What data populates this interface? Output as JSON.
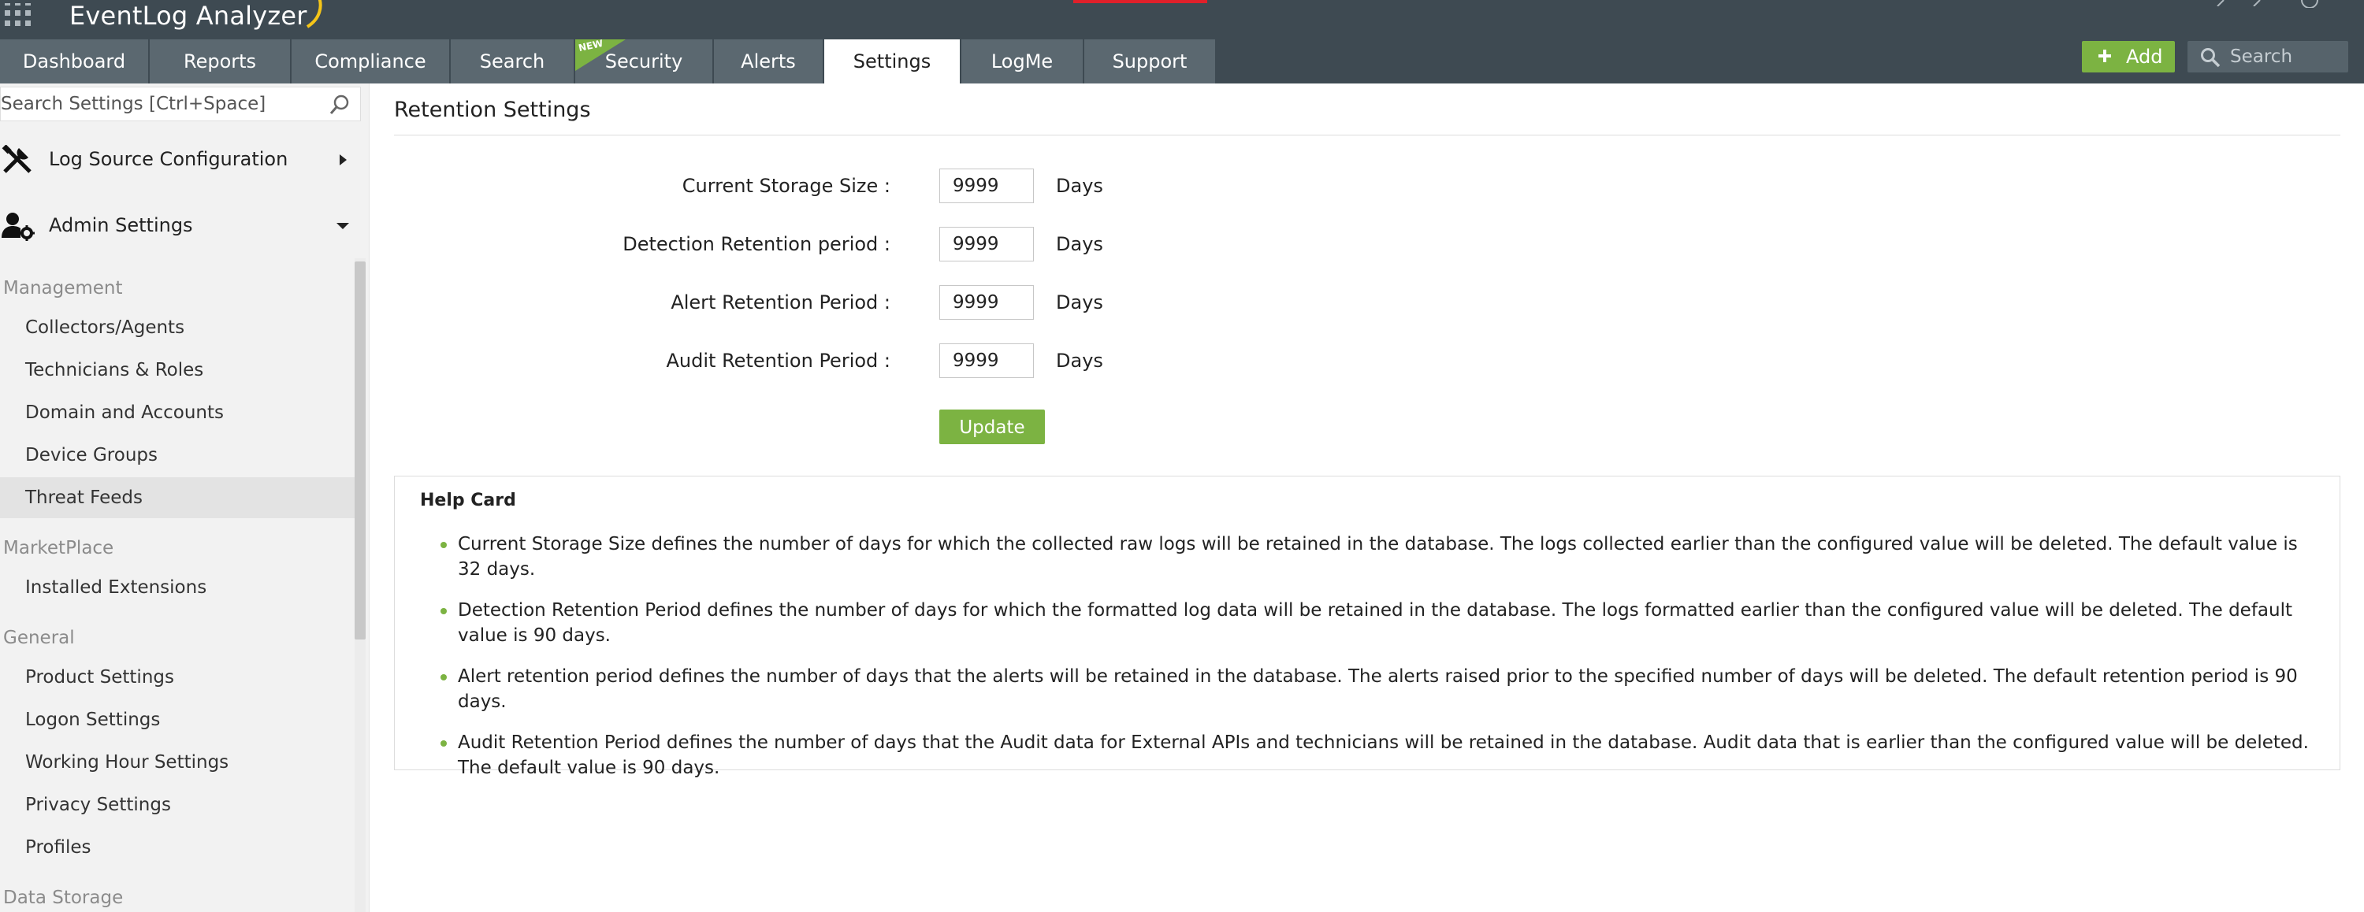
{
  "app": {
    "title": "EventLog Analyzer"
  },
  "nav": {
    "tabs": [
      {
        "label": "Dashboard"
      },
      {
        "label": "Reports"
      },
      {
        "label": "Compliance"
      },
      {
        "label": "Search"
      },
      {
        "label": "Security",
        "badge": "NEW"
      },
      {
        "label": "Alerts"
      },
      {
        "label": "Settings",
        "active": true
      },
      {
        "label": "LogMe"
      },
      {
        "label": "Support"
      }
    ],
    "add_label": "Add",
    "search_placeholder": "Search"
  },
  "sidebar": {
    "search_placeholder": "Search Settings [Ctrl+Space]",
    "sections": [
      {
        "label": "Log Source Configuration",
        "expanded": false
      },
      {
        "label": "Admin Settings",
        "expanded": true
      }
    ],
    "groups": [
      {
        "title": "Management",
        "items": [
          "Collectors/Agents",
          "Technicians & Roles",
          "Domain and Accounts",
          "Device Groups",
          "Threat Feeds"
        ]
      },
      {
        "title": "MarketPlace",
        "items": [
          "Installed Extensions"
        ]
      },
      {
        "title": "General",
        "items": [
          "Product Settings",
          "Logon Settings",
          "Working Hour Settings",
          "Privacy Settings",
          "Profiles"
        ]
      },
      {
        "title": "Data Storage",
        "items": []
      }
    ],
    "selected_item": "Threat Feeds"
  },
  "content": {
    "title": "Retention Settings",
    "fields": [
      {
        "label": "Current Storage Size :",
        "value": "9999",
        "unit": "Days"
      },
      {
        "label": "Detection Retention period :",
        "value": "9999",
        "unit": "Days"
      },
      {
        "label": "Alert Retention Period :",
        "value": "9999",
        "unit": "Days"
      },
      {
        "label": "Audit Retention Period :",
        "value": "9999",
        "unit": "Days"
      }
    ],
    "update_label": "Update",
    "help": {
      "title": "Help Card",
      "items": [
        "Current Storage Size defines the number of days for which the collected raw logs will be retained in the database. The logs collected earlier than the configured value will be deleted. The default value is 32 days.",
        "Detection Retention Period defines the number of days for which the formatted log data will be retained in the database. The logs formatted earlier than the configured value will be deleted. The default value is 90 days.",
        "Alert retention period defines the number of days that the alerts will be retained in the database. The alerts raised prior to the specified number of days will be deleted. The default retention period is 90 days.",
        "Audit Retention Period defines the number of days that the Audit data for External APIs and technicians will be retained in the database. Audit data that is earlier than the configured value will be deleted. The default value is 90 days."
      ]
    }
  },
  "colors": {
    "header_bg": "#3e4a52",
    "tab_bg": "#5b6870",
    "accent_green": "#7cb342",
    "alert_red": "#e0202a",
    "sidebar_bg": "#f2f2f2"
  }
}
